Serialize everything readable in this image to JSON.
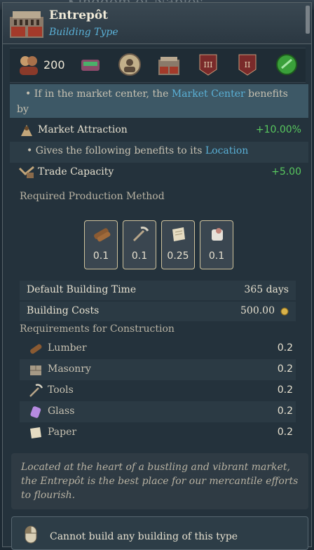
{
  "background": {
    "title": "Kingdom of Naples"
  },
  "header": {
    "title": "Entrepôt",
    "subtitle": "Building Type"
  },
  "iconbar": {
    "pop_value": "200",
    "icons": [
      "population-icon",
      "trade-goods-icon",
      "advisor-portrait-icon",
      "building-icon",
      "tier-three-icon",
      "tier-two-icon",
      "green-seal-icon"
    ],
    "tier_three": "III",
    "tier_two": "II"
  },
  "effects": {
    "market_condition_prefix": "• If in the market center, the ",
    "market_center_link": "Market Center",
    "market_condition_suffix": " benefits",
    "market_condition_wrap": "by",
    "market_attraction_label": "Market Attraction",
    "market_attraction_value": "+10.00%",
    "location_prefix": "• Gives the following benefits to its ",
    "location_link": "Location",
    "trade_capacity_label": "Trade Capacity",
    "trade_capacity_value": "+5.00"
  },
  "production": {
    "label": "Required Production Method",
    "inputs": [
      {
        "icon": "lumber-icon",
        "value": "0.1"
      },
      {
        "icon": "tools-icon",
        "value": "0.1"
      },
      {
        "icon": "paper-icon",
        "value": "0.25"
      },
      {
        "icon": "cloth-icon",
        "value": "0.1"
      }
    ]
  },
  "info": {
    "build_time_label": "Default Building Time",
    "build_time_value": "365 days",
    "cost_label": "Building Costs",
    "cost_value": "500.00"
  },
  "requirements": {
    "label": "Requirements for Construction",
    "items": [
      {
        "name": "Lumber",
        "value": "0.2",
        "icon": "lumber-icon"
      },
      {
        "name": "Masonry",
        "value": "0.2",
        "icon": "masonry-icon"
      },
      {
        "name": "Tools",
        "value": "0.2",
        "icon": "tools-icon"
      },
      {
        "name": "Glass",
        "value": "0.2",
        "icon": "glass-icon"
      },
      {
        "name": "Paper",
        "value": "0.2",
        "icon": "paper-icon"
      }
    ]
  },
  "description": "Located at the heart of a bustling and vibrant market, the Entrepôt is the best place for our mercantile efforts to flourish.",
  "footer": {
    "status": "Cannot build any building of this type"
  },
  "colors": {
    "link": "#5ab0d6",
    "positive": "#58c75e",
    "panel": "#24323c",
    "highlight": "#3d5866"
  }
}
